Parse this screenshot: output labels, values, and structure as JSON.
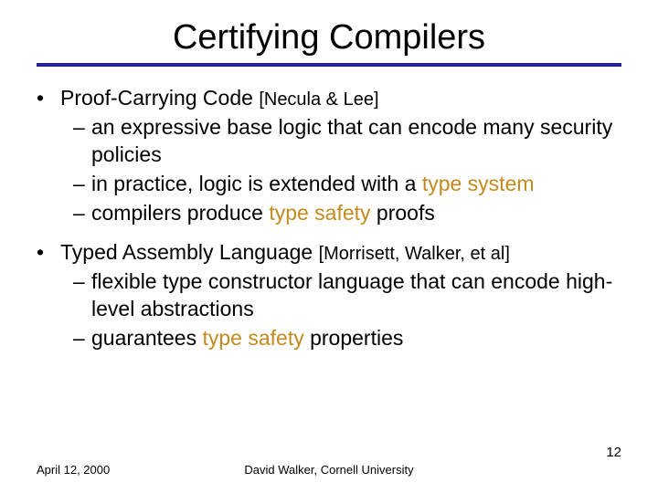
{
  "title": "Certifying Compilers",
  "bullets": [
    {
      "heading_plain": "Proof-Carrying Code",
      "citation": "[Necula & Lee]",
      "subs": [
        {
          "pre": "an expressive base logic that can encode many security policies",
          "hl": "",
          "post": ""
        },
        {
          "pre": "in practice, logic is extended with a ",
          "hl": "type system",
          "post": ""
        },
        {
          "pre": "compilers produce ",
          "hl": "type safety",
          "post": " proofs"
        }
      ]
    },
    {
      "heading_plain": "Typed Assembly Language",
      "citation": "[Morrisett, Walker, et al]",
      "subs": [
        {
          "pre": "flexible type constructor language that can encode high-level abstractions",
          "hl": "",
          "post": ""
        },
        {
          "pre": "guarantees ",
          "hl": "type safety",
          "post": " properties"
        }
      ]
    }
  ],
  "footer": {
    "date": "April 12, 2000",
    "center": "David Walker, Cornell University",
    "page": "12"
  }
}
